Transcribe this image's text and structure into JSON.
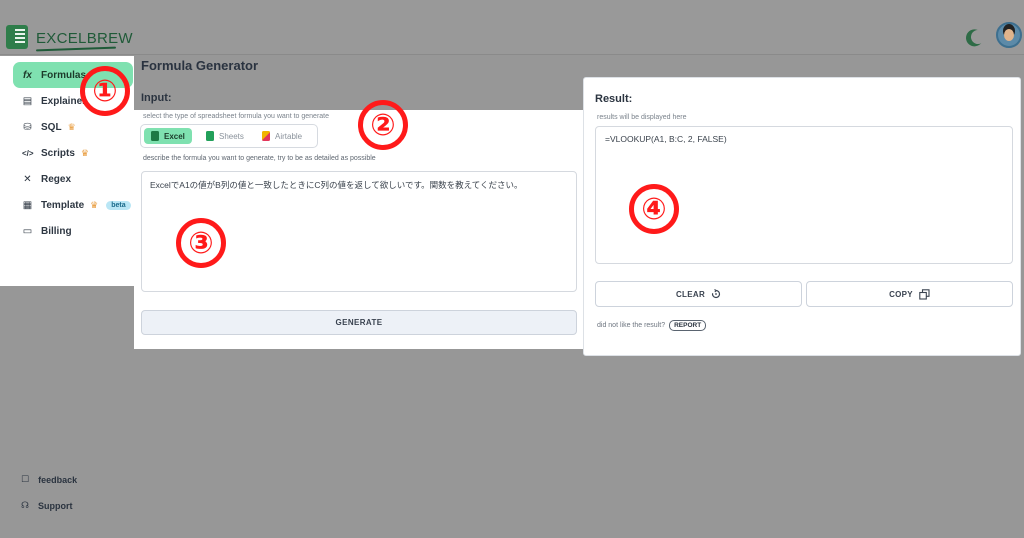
{
  "app": {
    "logo_text": "EXCELBREW"
  },
  "header": {
    "theme_icon": "moon-icon",
    "avatar_icon": "user-avatar"
  },
  "sidebar": {
    "items": [
      {
        "icon": "fx",
        "label": "Formulas"
      },
      {
        "icon": "▤",
        "label": "Explainer"
      },
      {
        "icon": "⛁",
        "label": "SQL",
        "crown": "♛"
      },
      {
        "icon": "</>",
        "label": "Scripts",
        "crown": "♛"
      },
      {
        "icon": "✕",
        "label": "Regex"
      },
      {
        "icon": "▦",
        "label": "Template",
        "crown": "♛",
        "badge": "beta"
      },
      {
        "icon": "▭",
        "label": "Billing"
      }
    ],
    "bottom": [
      {
        "icon": "☐",
        "label": "feedback"
      },
      {
        "icon": "☊",
        "label": "Support"
      }
    ]
  },
  "main": {
    "title": "Formula Generator",
    "input_label": "Input:",
    "type_hint": "select the type of spreadsheet formula you want to generate",
    "types": [
      {
        "label": "Excel",
        "color": "#1d7a44"
      },
      {
        "label": "Sheets",
        "color": "#22a05a"
      },
      {
        "label": "Airtable",
        "color": "#f0b400"
      }
    ],
    "desc_hint": "describe the formula you want to generate, try to be as detailed as possible",
    "prompt_text": "ExcelでA1の値がB列の値と一致したときにC列の値を返して欲しいです。関数を教えてください。",
    "generate_label": "GENERATE"
  },
  "result": {
    "title": "Result:",
    "hint": "results will be displayed here",
    "output": "=VLOOKUP(A1, B:C, 2, FALSE)",
    "clear_label": "CLEAR",
    "copy_label": "COPY",
    "feedback_text": "did not like the result?",
    "report_label": "REPORT"
  },
  "annotations": [
    "①",
    "②",
    "③",
    "④"
  ],
  "colors": {
    "accent": "#7fe1b0",
    "annotation": "#ff1a1a",
    "overlay": "#979797"
  }
}
